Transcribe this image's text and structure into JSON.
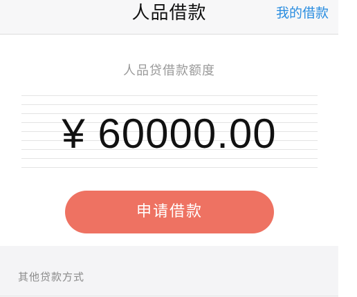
{
  "navbar": {
    "title": "人品借款",
    "right_link": "我的借款"
  },
  "main": {
    "limit_label": "人品贷借款额度",
    "amount": "¥ 60000.00",
    "apply_button": "申请借款"
  },
  "other": {
    "label": "其他贷款方式"
  },
  "colors": {
    "accent_button": "#ee7262",
    "link": "#2a8de0",
    "navbar_bg": "#f7f7f8",
    "section_bg": "#f4f4f6"
  }
}
